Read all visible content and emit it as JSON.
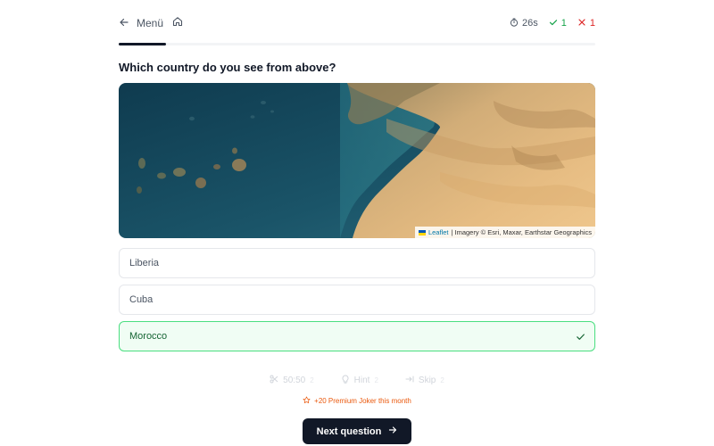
{
  "header": {
    "back_label": "Menü",
    "timer": "26s",
    "correct_count": "1",
    "wrong_count": "1"
  },
  "progress": {
    "fraction": 0.1
  },
  "question": "Which country do you see from above?",
  "map": {
    "attribution_leaflet": "Leaflet",
    "attribution_rest": "| Imagery © Esri, Maxar, Earthstar Geographics"
  },
  "options": [
    {
      "label": "Liberia",
      "selected": false
    },
    {
      "label": "Cuba",
      "selected": false
    },
    {
      "label": "Morocco",
      "selected": true
    }
  ],
  "jokers": {
    "fifty": {
      "label": "50:50",
      "count": "2"
    },
    "hint": {
      "label": "Hint",
      "count": "2"
    },
    "skip": {
      "label": "Skip",
      "count": "2"
    }
  },
  "premium_text": "+20 Premium Joker this month",
  "next_label": "Next question",
  "colors": {
    "accent": "#111827",
    "correct": "#16a34a",
    "wrong": "#dc2626",
    "selected_bg": "#f0fdf4",
    "selected_border": "#4ade80",
    "premium": "#ea580c"
  }
}
